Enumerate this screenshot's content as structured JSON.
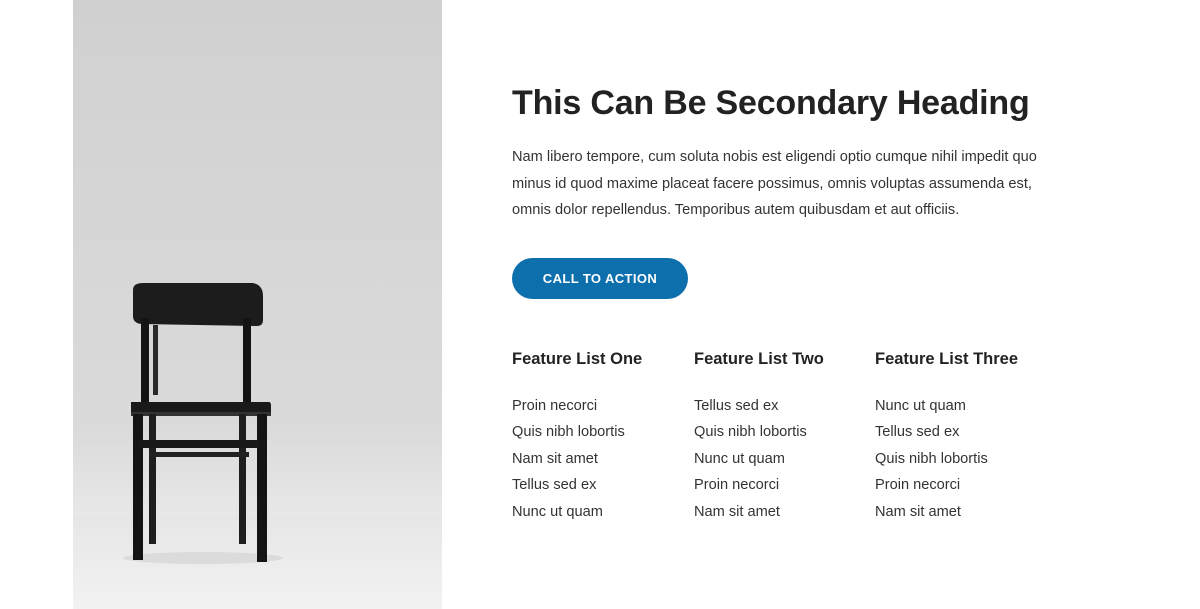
{
  "hero_image": {
    "subject": "black wooden chair"
  },
  "section": {
    "heading": "This Can Be Secondary Heading",
    "paragraph": "Nam libero tempore, cum soluta nobis est eligendi optio cumque nihil impedit quo minus id quod maxime placeat facere possimus, omnis voluptas assumenda est, omnis dolor repellendus. Temporibus autem quibusdam et aut officiis.",
    "cta_label": "CALL TO ACTION",
    "cta_color": "#0e6fad"
  },
  "features": [
    {
      "title": "Feature List One",
      "items": [
        "Proin necorci",
        "Quis nibh lobortis",
        "Nam sit amet",
        "Tellus sed ex",
        "Nunc ut quam"
      ]
    },
    {
      "title": "Feature List Two",
      "items": [
        "Tellus sed ex",
        "Quis nibh lobortis",
        "Nunc ut quam",
        "Proin necorci",
        "Nam sit amet"
      ]
    },
    {
      "title": "Feature List Three",
      "items": [
        "Nunc ut quam",
        "Tellus sed ex",
        "Quis nibh lobortis",
        "Proin necorci",
        "Nam sit amet"
      ]
    }
  ]
}
